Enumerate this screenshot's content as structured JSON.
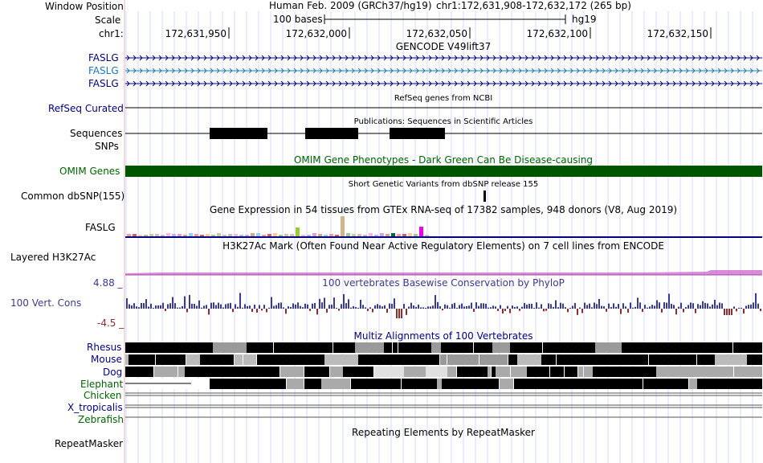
{
  "header": {
    "window_position_label": "Window Position",
    "scale_label": "Scale",
    "chrom_label": "chr1:",
    "assembly": "Human Feb. 2009 (GRCh37/hg19)",
    "position": "chr1:172,631,908-172,632,172 (265 bp)",
    "scale_text": "100 bases",
    "db": "hg19",
    "ruler_ticks": [
      "172,631,950",
      "172,632,000",
      "172,632,050",
      "172,632,100",
      "172,632,150"
    ]
  },
  "tracks": {
    "gencode": {
      "title": "GENCODE V49lift37",
      "genes": [
        "FASLG",
        "FASLG",
        "FASLG"
      ],
      "colors": [
        "#000080",
        "#1f77b4",
        "#000080"
      ]
    },
    "refseq": {
      "label": "RefSeq Curated",
      "title": "RefSeq genes from NCBI"
    },
    "publications": {
      "label": "Sequences",
      "title": "Publications: Sequences in Scientific Articles"
    },
    "snps": {
      "label": "SNPs"
    },
    "omim": {
      "label": "OMIM Genes",
      "title": "OMIM Gene Phenotypes - Dark Green Can Be Disease-causing",
      "color": "#005500"
    },
    "dbsnp": {
      "label": "Common dbSNP(155)",
      "title": "Short Genetic Variants from dbSNP release 155"
    },
    "gtex": {
      "label": "FASLG",
      "title": "Gene Expression in 54 tissues from GTEx RNA-seq of 17382 samples, 948 donors (V8, Aug 2019)"
    },
    "h3k27ac": {
      "label": "Layered H3K27Ac",
      "title": "H3K27Ac Mark (Often Found Near Active Regulatory Elements) on 7 cell lines from ENCODE"
    },
    "conservation": {
      "label": "100 Vert. Cons",
      "title": "100 vertebrates Basewise Conservation by PhyloP",
      "max_label": "4.88 _",
      "min_label": "-4.5 _",
      "pos_color": "#3b3b8c",
      "neg_color": "#8b2e2e"
    },
    "multiz": {
      "title": "Multiz Alignments of 100 Vertebrates",
      "species": [
        "Rhesus",
        "Mouse",
        "Dog",
        "Elephant",
        "Chicken",
        "X_tropicalis",
        "Zebrafish"
      ]
    },
    "repeatmasker": {
      "label": "RepeatMasker",
      "title": "Repeating Elements by RepeatMasker"
    }
  }
}
